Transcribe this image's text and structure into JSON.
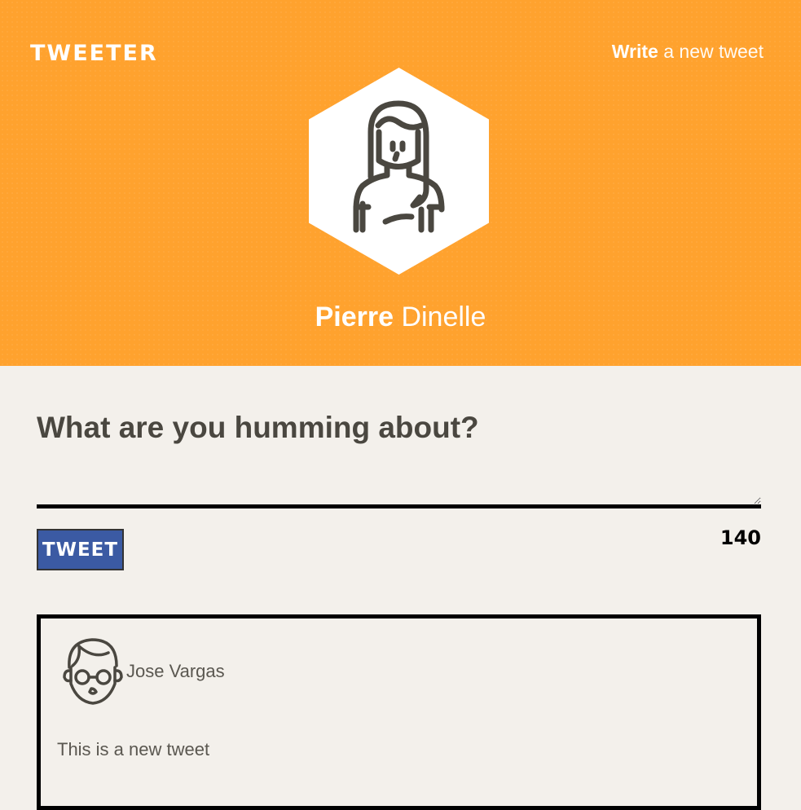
{
  "header": {
    "logo": "TWEETER",
    "write_link": {
      "bold": "Write",
      "rest": "a new tweet"
    },
    "profile": {
      "first_name": "Pierre",
      "last_name": "Dinelle",
      "avatar_icon": "woman-avatar-icon"
    },
    "background_color": "#ffa22e"
  },
  "composer": {
    "question": "What are you humming about?",
    "textarea_value": "",
    "tweet_button_label": "TWEET",
    "char_count": "140"
  },
  "tweets": [
    {
      "author": "Jose Vargas",
      "avatar_icon": "man-glasses-avatar-icon",
      "text": "This is a new tweet"
    }
  ],
  "colors": {
    "accent": "#ffa22e",
    "button": "#3b5aa3",
    "text": "#4a4740",
    "page_bg": "#f3f0eb"
  }
}
